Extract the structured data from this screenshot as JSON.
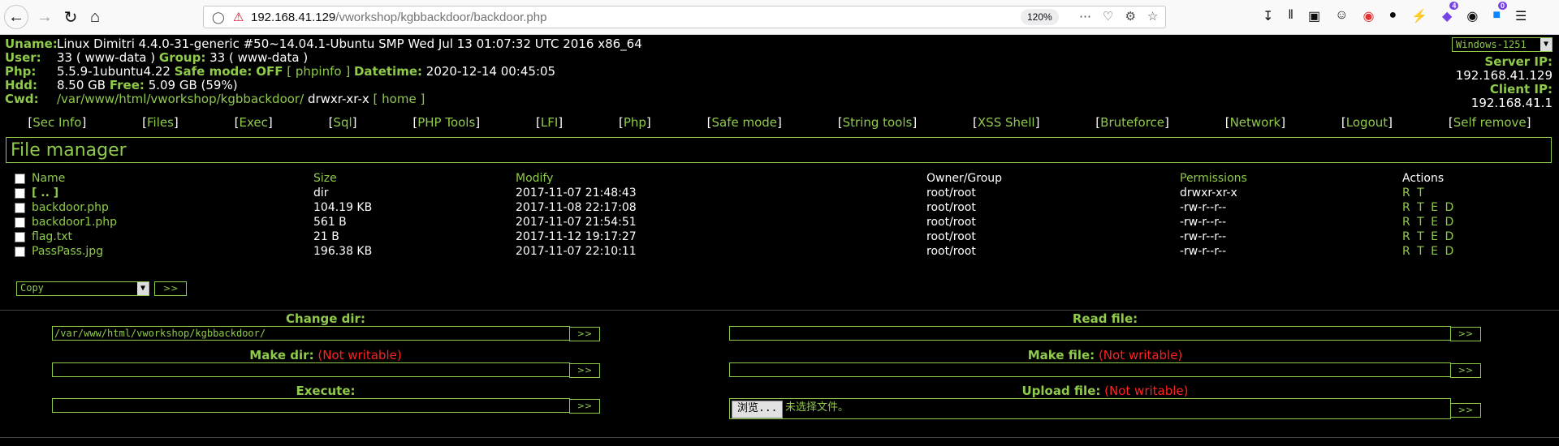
{
  "browser": {
    "url_host": "192.168.41.129",
    "url_path": "/vworkshop/kgbbackdoor/backdoor.php",
    "zoom": "120%",
    "notif_badge_1": "4",
    "notif_badge_2": "0"
  },
  "sysinfo": {
    "uname_label": "Uname:",
    "uname": "Linux Dimitri 4.4.0-31-generic #50~14.04.1-Ubuntu SMP Wed Jul 13 01:07:32 UTC 2016 x86_64",
    "user_label": "User:",
    "user_val": "33 ( www-data )",
    "group_label": "Group:",
    "group_val": "33 ( www-data )",
    "php_label": "Php:",
    "php_val": "5.5.9-1ubuntu4.22",
    "safemode_label": "Safe mode:",
    "safemode_val": "OFF",
    "phpinfo_link": "[ phpinfo ]",
    "datetime_label": "Datetime:",
    "datetime_val": "2020-12-14 00:45:05",
    "hdd_label": "Hdd:",
    "hdd_val": "8.50 GB",
    "free_label": "Free:",
    "free_val": "5.09 GB (59%)",
    "cwd_label": "Cwd:",
    "cwd_val": "/var/www/html/vworkshop/kgbbackdoor/",
    "cwd_perms": "drwxr-xr-x",
    "home_link": "[ home ]"
  },
  "right": {
    "encoding": "Windows-1251",
    "server_ip_label": "Server IP:",
    "server_ip": "192.168.41.129",
    "client_ip_label": "Client IP:",
    "client_ip": "192.168.41.1"
  },
  "menu": [
    "Sec Info",
    "Files",
    "Exec",
    "Sql",
    "PHP Tools",
    "LFI",
    "Php",
    "Safe mode",
    "String tools",
    "XSS Shell",
    "Bruteforce",
    "Network",
    "Logout",
    "Self remove"
  ],
  "file_manager": {
    "title": "File manager",
    "columns": [
      "Name",
      "Size",
      "Modify",
      "Owner/Group",
      "Permissions",
      "Actions"
    ],
    "rows": [
      {
        "name": "[ .. ]",
        "size": "dir",
        "modify": "2017-11-07 21:48:43",
        "owner": "root/root",
        "perms": "drwxr-xr-x",
        "actions": "R T"
      },
      {
        "name": "backdoor.php",
        "size": "104.19 KB",
        "modify": "2017-11-08 22:17:08",
        "owner": "root/root",
        "perms": "-rw-r--r--",
        "actions": "R T E D"
      },
      {
        "name": "backdoor1.php",
        "size": "561 B",
        "modify": "2017-11-07 21:54:51",
        "owner": "root/root",
        "perms": "-rw-r--r--",
        "actions": "R T E D"
      },
      {
        "name": "flag.txt",
        "size": "21 B",
        "modify": "2017-11-12 19:17:27",
        "owner": "root/root",
        "perms": "-rw-r--r--",
        "actions": "R T E D"
      },
      {
        "name": "PassPass.jpg",
        "size": "196.38 KB",
        "modify": "2017-11-07 22:10:11",
        "owner": "root/root",
        "perms": "-rw-r--r--",
        "actions": "R T E D"
      }
    ],
    "bulk_action": "Copy",
    "go_label": ">>"
  },
  "forms": {
    "change_dir_label": "Change dir:",
    "change_dir_value": "/var/www/html/vworkshop/kgbbackdoor/",
    "make_dir_label": "Make dir:",
    "not_writable": "(Not writable)",
    "execute_label": "Execute:",
    "read_file_label": "Read file:",
    "make_file_label": "Make file:",
    "upload_file_label": "Upload file:",
    "browse_label": "浏览...",
    "no_file_label": "未选择文件。",
    "go": ">>"
  }
}
